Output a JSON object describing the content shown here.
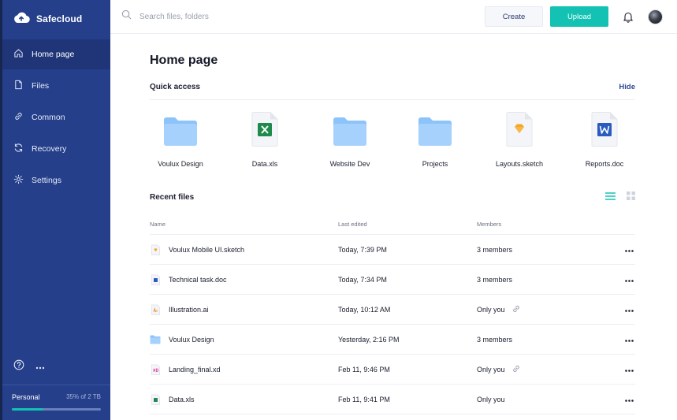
{
  "app": {
    "name": "Safecloud"
  },
  "sidebar": {
    "items": [
      {
        "label": "Home page",
        "icon": "home-icon",
        "active": true
      },
      {
        "label": "Files",
        "icon": "file-icon",
        "active": false
      },
      {
        "label": "Common",
        "icon": "link-icon",
        "active": false
      },
      {
        "label": "Recovery",
        "icon": "refresh-icon",
        "active": false
      },
      {
        "label": "Settings",
        "icon": "gear-icon",
        "active": false
      }
    ],
    "storage": {
      "plan": "Personal",
      "used_label": "35% of 2 TB",
      "fraction": 0.35
    }
  },
  "topbar": {
    "search_placeholder": "Search files, folders",
    "create_label": "Create",
    "upload_label": "Upload"
  },
  "page": {
    "title": "Home page"
  },
  "quick_access": {
    "title": "Quick access",
    "hide_label": "Hide",
    "items": [
      {
        "label": "Voulux Design",
        "type": "folder"
      },
      {
        "label": "Data.xls",
        "type": "xls"
      },
      {
        "label": "Website Dev",
        "type": "folder"
      },
      {
        "label": "Projects",
        "type": "folder"
      },
      {
        "label": "Layouts.sketch",
        "type": "sketch"
      },
      {
        "label": "Reports.doc",
        "type": "doc"
      }
    ]
  },
  "recent": {
    "title": "Recent files",
    "columns": {
      "name": "Name",
      "edited": "Last edited",
      "members": "Members"
    },
    "rows": [
      {
        "name": "Voulux Mobile UI.sketch",
        "type": "sketch",
        "edited": "Today, 7:39 PM",
        "members": "3 members",
        "shared_link": false
      },
      {
        "name": "Technical task.doc",
        "type": "doc",
        "edited": "Today, 7:34 PM",
        "members": "3 members",
        "shared_link": false
      },
      {
        "name": "Illustration.ai",
        "type": "ai",
        "edited": "Today, 10:12 AM",
        "members": "Only you",
        "shared_link": true
      },
      {
        "name": "Voulux Design",
        "type": "folder",
        "edited": "Yesterday, 2:16 PM",
        "members": "3 members",
        "shared_link": false
      },
      {
        "name": "Landing_final.xd",
        "type": "xd",
        "edited": "Feb 11, 9:46 PM",
        "members": "Only you",
        "shared_link": true
      },
      {
        "name": "Data.xls",
        "type": "xls",
        "edited": "Feb 11, 9:41 PM",
        "members": "Only you",
        "shared_link": false
      }
    ]
  },
  "colors": {
    "sidebar": "#253f8a",
    "accent": "#13c2b3",
    "folder": "#8cc3fb"
  }
}
